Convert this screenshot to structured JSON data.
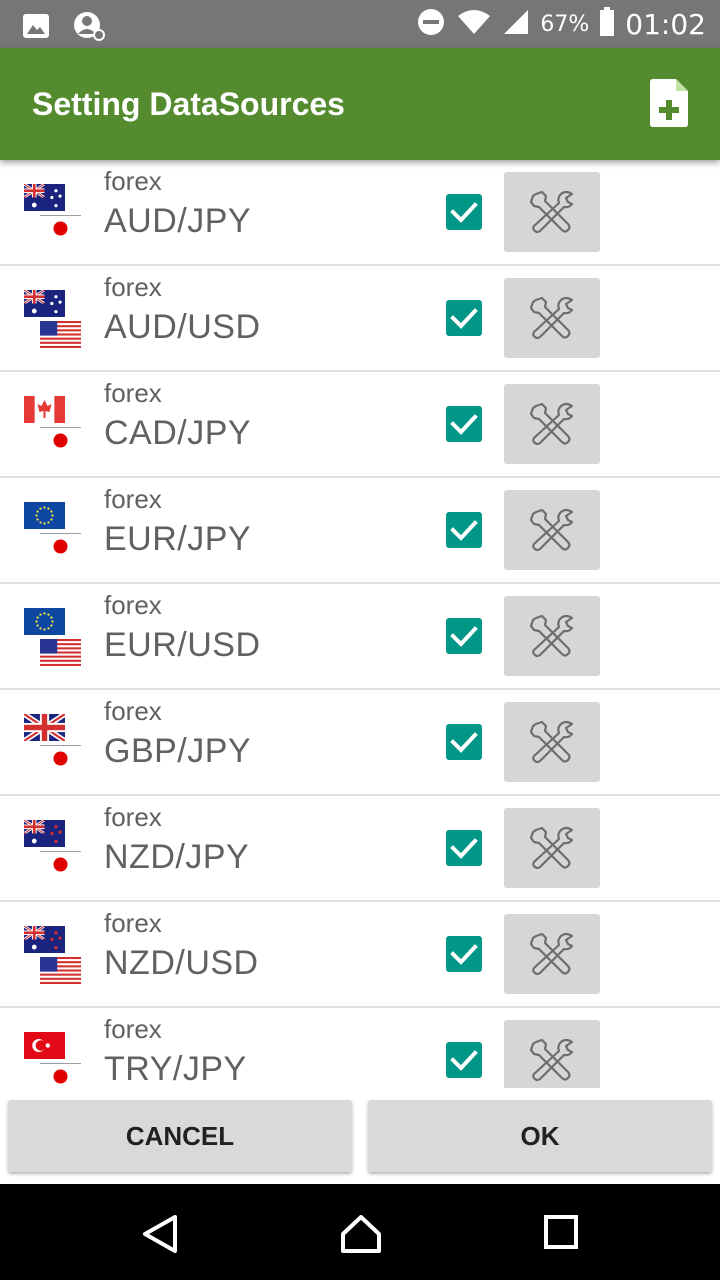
{
  "status_bar": {
    "battery_percent": "67%",
    "time": "01:02",
    "icons": [
      "image-icon",
      "sync-person-icon",
      "do-not-disturb-icon",
      "wifi-icon",
      "cell-signal-icon",
      "battery-icon"
    ]
  },
  "toolbar": {
    "title": "Setting DataSources",
    "add_icon": "add-file-icon",
    "color": "#558b2f"
  },
  "rows": [
    {
      "category": "forex",
      "pair": "AUD/JPY",
      "base_flag": "au",
      "quote_flag": "jp",
      "checked": true
    },
    {
      "category": "forex",
      "pair": "AUD/USD",
      "base_flag": "au",
      "quote_flag": "us",
      "checked": true
    },
    {
      "category": "forex",
      "pair": "CAD/JPY",
      "base_flag": "ca",
      "quote_flag": "jp",
      "checked": true
    },
    {
      "category": "forex",
      "pair": "EUR/JPY",
      "base_flag": "eu",
      "quote_flag": "jp",
      "checked": true
    },
    {
      "category": "forex",
      "pair": "EUR/USD",
      "base_flag": "eu",
      "quote_flag": "us",
      "checked": true
    },
    {
      "category": "forex",
      "pair": "GBP/JPY",
      "base_flag": "gb",
      "quote_flag": "jp",
      "checked": true
    },
    {
      "category": "forex",
      "pair": "NZD/JPY",
      "base_flag": "nz",
      "quote_flag": "jp",
      "checked": true
    },
    {
      "category": "forex",
      "pair": "NZD/USD",
      "base_flag": "nz",
      "quote_flag": "us",
      "checked": true
    },
    {
      "category": "forex",
      "pair": "TRY/JPY",
      "base_flag": "tr",
      "quote_flag": "jp",
      "checked": true
    }
  ],
  "buttons": {
    "cancel": "CANCEL",
    "ok": "OK"
  },
  "nav": {
    "icons": [
      "back-icon",
      "home-icon",
      "recents-icon"
    ]
  },
  "colors": {
    "checkbox": "#009688",
    "tool_button": "#d6d6d6"
  }
}
